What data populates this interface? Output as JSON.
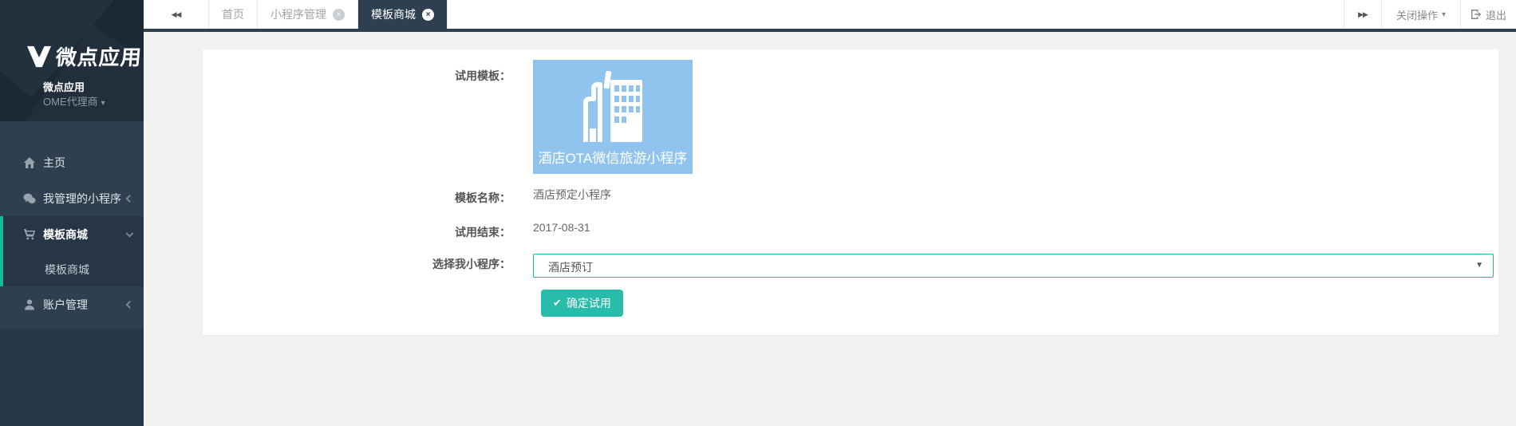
{
  "colors": {
    "sidebar_dark": "#2e4050",
    "logo_bg": "#1b2836",
    "active_item_bg": "#263646",
    "accent_teal": "#18bc9c",
    "button_teal": "#28bcab",
    "select_border": "#1cbc9c",
    "tile_blue": "#90c4ef",
    "tab_active_bg": "#2e4050",
    "content_bg": "#f2f2f3"
  },
  "sidebar": {
    "logo_text": "微点应用",
    "account": {
      "name": "微点应用",
      "role": "OME代理商",
      "role_caret": "▾"
    },
    "items": [
      {
        "label": "主页",
        "icon": "home-icon"
      },
      {
        "label": "我管理的小程序",
        "icon": "wechat-icon",
        "chevron": "left"
      },
      {
        "label": "模板商城",
        "icon": "cart-icon",
        "chevron": "down",
        "active": true
      },
      {
        "label": "账户管理",
        "icon": "user-icon",
        "chevron": "left"
      }
    ],
    "submenu_item": "模板商城"
  },
  "tabbar": {
    "back_glyph": "◀◀",
    "forward_glyph": "▶▶",
    "close_glyph": "×",
    "tabs": [
      {
        "label": "首页",
        "closable": false,
        "active": false
      },
      {
        "label": "小程序管理",
        "closable": true,
        "active": false
      },
      {
        "label": "模板商城",
        "closable": true,
        "active": true
      }
    ],
    "actions": {
      "close_ops": "关闭操作",
      "caret": "▾",
      "logout": "退出"
    }
  },
  "form": {
    "trial_template_label": "试用模板：",
    "template_card_caption": "酒店OTA微信旅游小程序",
    "template_name_label": "模板名称：",
    "template_name_value": "酒店预定小程序",
    "trial_end_label": "试用结束：",
    "trial_end_value": "2017-08-31",
    "select_label": "选择我小程序：",
    "select_value": "酒店预订",
    "submit_check": "✔",
    "submit_label": "确定试用"
  }
}
